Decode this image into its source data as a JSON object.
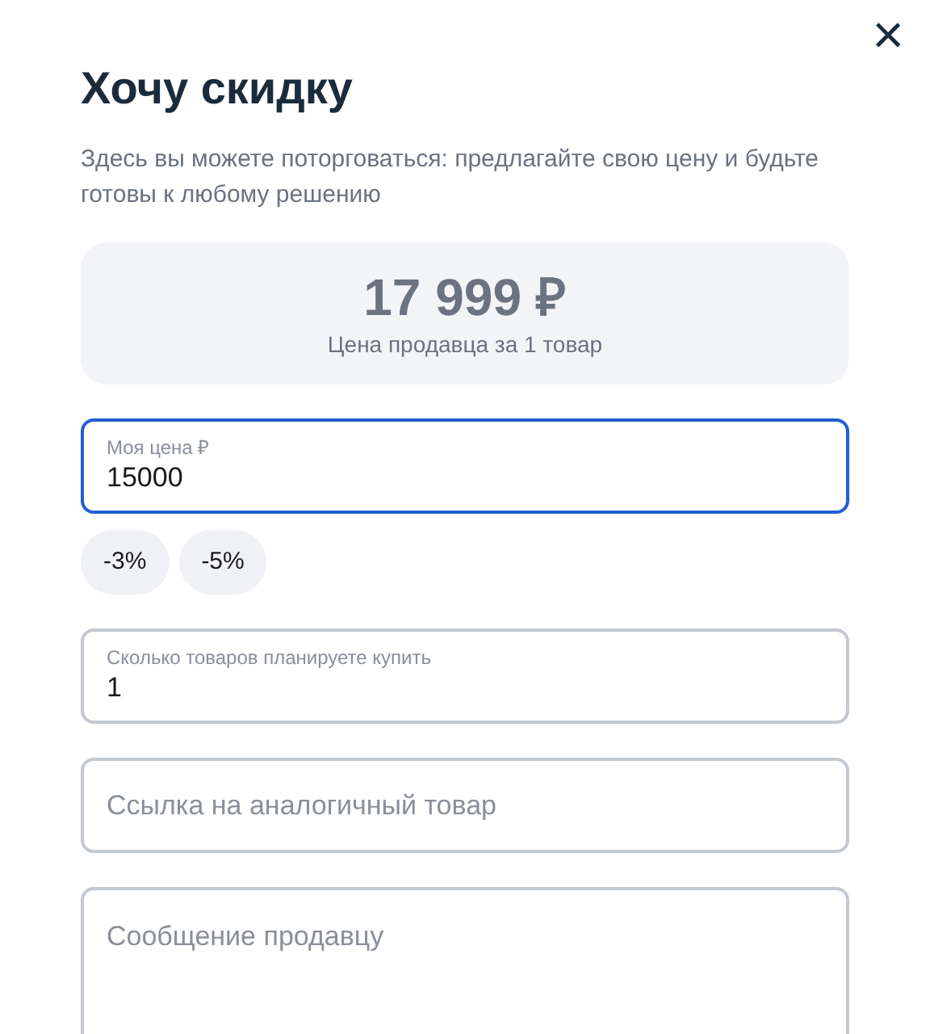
{
  "close_button": {
    "label": "×"
  },
  "title": "Хочу скидку",
  "description": "Здесь вы можете поторговаться: предлагайте свою цену и будьте готовы к любому решению",
  "price_card": {
    "price": "17 999 ₽",
    "caption": "Цена продавца за 1 товар"
  },
  "price_field": {
    "label": "Моя цена ₽",
    "value": "15000",
    "focused": true
  },
  "discount_chips": [
    "-3%",
    "-5%"
  ],
  "fields": [
    {
      "kind": "input",
      "label": "Сколько товаров планируете купить",
      "value": "1",
      "focused": false
    },
    {
      "kind": "input",
      "placeholder": "Ссылка на аналогичный товар",
      "focused": false
    },
    {
      "kind": "textarea",
      "placeholder": "Сообщение продавцу",
      "focused": false
    }
  ]
}
